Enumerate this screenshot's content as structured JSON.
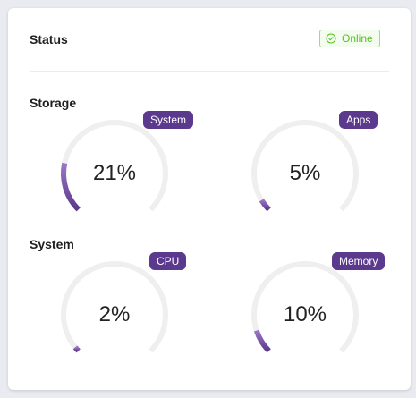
{
  "status": {
    "title": "Status",
    "badge_label": "Online",
    "badge_icon": "check-circle-icon",
    "badge_color": "#52c41a"
  },
  "storage": {
    "title": "Storage",
    "gauges": [
      {
        "label": "System",
        "value_text": "21%",
        "percent": 21
      },
      {
        "label": "Apps",
        "value_text": "5%",
        "percent": 5
      }
    ]
  },
  "system": {
    "title": "System",
    "gauges": [
      {
        "label": "CPU",
        "value_text": "2%",
        "percent": 2
      },
      {
        "label": "Memory",
        "value_text": "10%",
        "percent": 10
      }
    ]
  },
  "colors": {
    "accent": "#5b3a8e",
    "track": "#efefef",
    "card_bg": "#ffffff",
    "page_bg": "#e9ebf0"
  }
}
